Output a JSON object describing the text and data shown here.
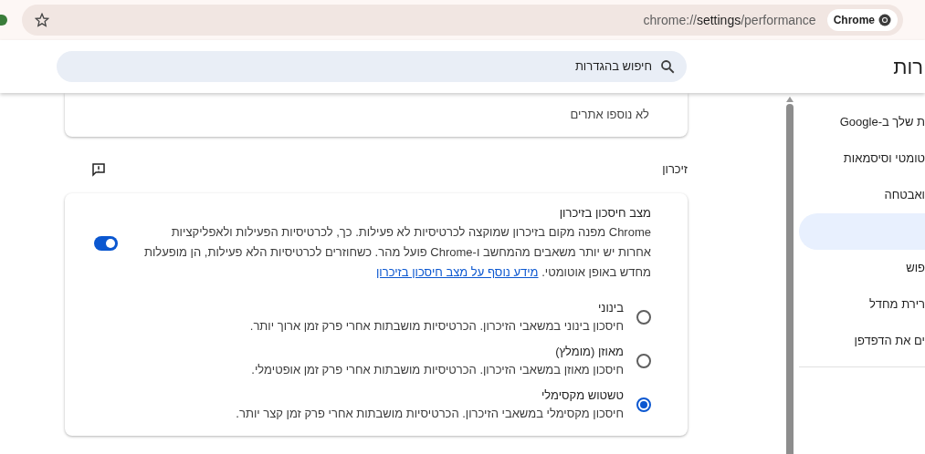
{
  "toolbar": {
    "url_prefix": "chrome://",
    "url_host": "settings",
    "url_path": "/performance",
    "chip": "Chrome"
  },
  "header": {
    "title": "רות",
    "search": {
      "placeholder": "חיפוש בהגדרות"
    }
  },
  "sidebar": {
    "items": [
      {
        "label": "ת שלך ב-Google",
        "selected": false
      },
      {
        "label": "טומטי וסיסמאות",
        "selected": false
      },
      {
        "label": "ואבטחה",
        "selected": false
      },
      {
        "selected": true
      },
      {
        "label": "פוש",
        "selected": false
      },
      {
        "label": "רירת מחדל",
        "selected": false
      },
      {
        "label": "ים את הדפדפן",
        "selected": false
      }
    ]
  },
  "sites_card": {
    "empty_text": "לא נוספו אתרים"
  },
  "memory": {
    "heading": "זיכרון",
    "saver": {
      "title": "מצב חיסכון בזיכרון",
      "description": "Chrome מפנה מקום בזיכרון שמוקצה לכרטיסיות לא פעילות. כך, לכרטיסיות הפעילות ולאפליקציות אחרות יש יותר משאבים מהמחשב ו-Chrome פועל מהר. כשחוזרים לכרטיסיות הלא פעילות, הן מופעלות מחדש באופן אוטומטי.",
      "link": "מידע נוסף על מצב חיסכון בזיכרון",
      "on": true
    },
    "options": [
      {
        "label": "בינוני",
        "description": "חיסכון בינוני במשאבי הזיכרון. הכרטיסיות מושבתות אחרי פרק זמן ארוך יותר.",
        "selected": false
      },
      {
        "label": "מאוזן (מומלץ)",
        "description": "חיסכון מאוזן במשאבי הזיכרון. הכרטיסיות מושבתות אחרי פרק זמן אופטימלי.",
        "selected": false
      },
      {
        "label": "טשטוש מקסימלי",
        "description": "חיסכון מקסימלי במשאבי הזיכרון. הכרטיסיות מושבתות אחרי פרק זמן קצר יותר.",
        "selected": true
      }
    ]
  }
}
